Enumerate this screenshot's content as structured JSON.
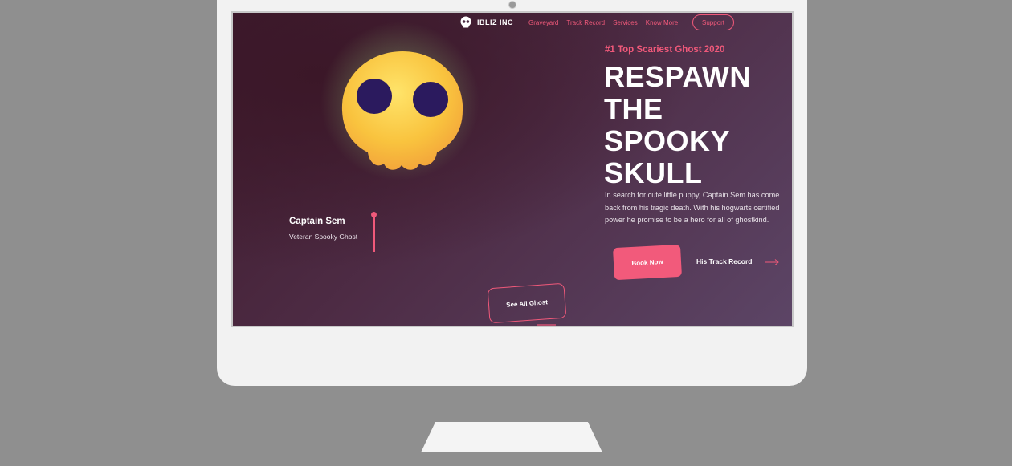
{
  "brand": {
    "name": "IBLIZ INC",
    "icon": "skull-icon"
  },
  "nav": {
    "links": [
      "Graveyard",
      "Track Record",
      "Services",
      "Know More"
    ],
    "support_label": "Support"
  },
  "hero": {
    "kicker": "#1 Top Scariest Ghost 2020",
    "headline_lines": [
      "RESPAWN",
      "THE",
      "SPOOKY",
      "SKULL"
    ],
    "description": "In search for cute little puppy, Captain Sem has come back from his tragic death. With his hogwarts certified power he promise to be a hero for all of ghostkind.",
    "primary_button": "Book Now",
    "secondary_link": "His Track Record"
  },
  "profile": {
    "name": "Captain Sem",
    "role": "Veteran Spooky Ghost"
  },
  "see_all_label": "See All Ghost",
  "colors": {
    "accent": "#f0597a",
    "background": "#4a2a42",
    "bezel": "#f2f2f2",
    "desk": "#8f8f8f"
  }
}
